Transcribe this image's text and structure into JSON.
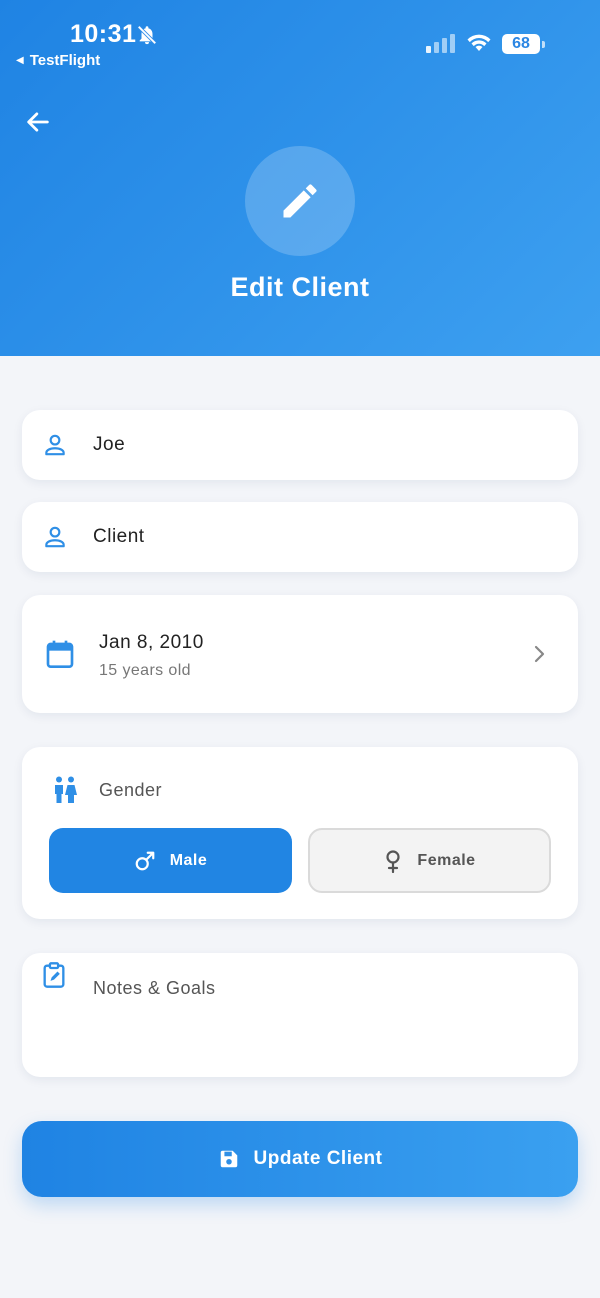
{
  "status_bar": {
    "time": "10:31",
    "back_app": "TestFlight",
    "battery": "68"
  },
  "header": {
    "title": "Edit Client"
  },
  "form": {
    "first_name": "Joe",
    "last_name": "Client",
    "birth_date": "Jan 8, 2010",
    "age": "15 years old",
    "gender_label": "Gender",
    "gender_options": [
      "Male",
      "Female"
    ],
    "gender_selected": "Male",
    "notes_placeholder": "Notes & Goals"
  },
  "actions": {
    "update_label": "Update Client"
  },
  "colors": {
    "primary": "#2185e3",
    "accent_light": "#3da0f0",
    "background": "#f3f5f9"
  },
  "icons": {
    "first_name": "person-icon",
    "last_name": "person-icon",
    "birth_date": "calendar-icon",
    "gender": "wc-icon",
    "notes": "clipboard-edit-icon",
    "update": "save-icon",
    "hero": "pencil-icon"
  }
}
